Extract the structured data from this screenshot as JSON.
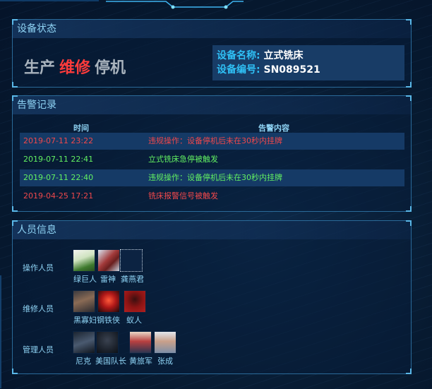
{
  "device_status": {
    "title": "设备状态",
    "states": [
      {
        "label": "生产",
        "color": "#a9b3bd"
      },
      {
        "label": "维修",
        "color": "#ff3b3b"
      },
      {
        "label": "停机",
        "color": "#a9b3bd"
      }
    ],
    "name_key": "设备名称:",
    "name_value": "立式铣床",
    "code_key": "设备编号:",
    "code_value": "SN089521"
  },
  "alarm": {
    "title": "告警记录",
    "col_time": "时间",
    "col_content": "告警内容",
    "rows": [
      {
        "time": "2019-07-11 23:22",
        "content": "违规操作：设备停机后未在30秒内挂牌",
        "color": "#f0484b"
      },
      {
        "time": "2019-07-11 22:41",
        "content": "立式铣床急停被触发",
        "color": "#62f062"
      },
      {
        "time": "2019-07-11 22:40",
        "content": "违规操作：设备停机后未在30秒内挂牌",
        "color": "#62f062"
      },
      {
        "time": "2019-04-25 17:21",
        "content": "铣床报警信号被触发",
        "color": "#f0484b"
      }
    ]
  },
  "personnel": {
    "title": "人员信息",
    "groups": [
      {
        "role": "操作人员",
        "people": [
          "绿巨人",
          "雷神",
          "龚燕君"
        ]
      },
      {
        "role": "维修人员",
        "people": [
          "黑寡妇",
          "钢铁侠",
          "蚁人"
        ]
      },
      {
        "role": "管理人员",
        "people": [
          "尼克",
          "美国队长",
          "黄旅军",
          "张成"
        ]
      }
    ]
  }
}
